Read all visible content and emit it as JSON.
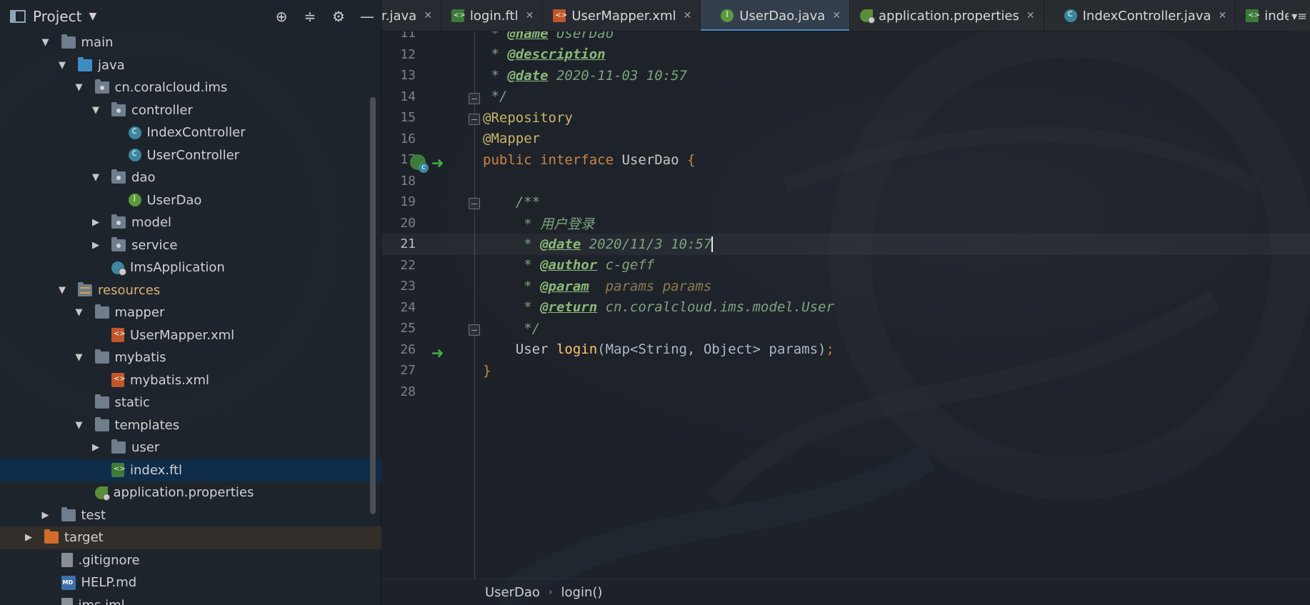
{
  "project_panel": {
    "title": "Project",
    "dropdown": "▼",
    "tools": {
      "locate": "⊕",
      "collapse": "≑",
      "settings": "⚙",
      "hide": "—"
    },
    "tree": [
      {
        "label": "main",
        "icon": "folder-icon",
        "depth": 1,
        "arrow": "▼"
      },
      {
        "label": "java",
        "icon": "source-folder-icon",
        "depth": 2,
        "arrow": "▼"
      },
      {
        "label": "cn.coralcloud.ims",
        "icon": "package-icon",
        "depth": 3,
        "arrow": "▼"
      },
      {
        "label": "controller",
        "icon": "package-icon",
        "depth": 4,
        "arrow": "▼"
      },
      {
        "label": "IndexController",
        "icon": "class-icon",
        "depth": 5,
        "arrow": ""
      },
      {
        "label": "UserController",
        "icon": "class-icon",
        "depth": 5,
        "arrow": ""
      },
      {
        "label": "dao",
        "icon": "package-icon",
        "depth": 4,
        "arrow": "▼"
      },
      {
        "label": "UserDao",
        "icon": "interface-icon",
        "depth": 5,
        "arrow": ""
      },
      {
        "label": "model",
        "icon": "package-icon",
        "depth": 4,
        "arrow": "▶"
      },
      {
        "label": "service",
        "icon": "package-icon",
        "depth": 4,
        "arrow": "▶"
      },
      {
        "label": "ImsApplication",
        "icon": "spring-app-icon",
        "depth": 4,
        "arrow": ""
      },
      {
        "label": "resources",
        "icon": "resources-folder-icon",
        "depth": 2,
        "arrow": "▼"
      },
      {
        "label": "mapper",
        "icon": "folder-icon",
        "depth": 3,
        "arrow": "▼"
      },
      {
        "label": "UserMapper.xml",
        "icon": "xml-file-icon",
        "depth": 4,
        "arrow": ""
      },
      {
        "label": "mybatis",
        "icon": "folder-icon",
        "depth": 3,
        "arrow": "▼"
      },
      {
        "label": "mybatis.xml",
        "icon": "xml-file-icon",
        "depth": 4,
        "arrow": ""
      },
      {
        "label": "static",
        "icon": "folder-icon",
        "depth": 3,
        "arrow": ""
      },
      {
        "label": "templates",
        "icon": "folder-icon",
        "depth": 3,
        "arrow": "▼"
      },
      {
        "label": "user",
        "icon": "folder-icon",
        "depth": 4,
        "arrow": "▶"
      },
      {
        "label": "index.ftl",
        "icon": "ftl-file-icon",
        "depth": 4,
        "arrow": "",
        "selected": true
      },
      {
        "label": "application.properties",
        "icon": "properties-file-icon",
        "depth": 3,
        "arrow": ""
      },
      {
        "label": "test",
        "icon": "folder-icon",
        "depth": 1,
        "arrow": "▶"
      },
      {
        "label": "target",
        "icon": "excluded-folder-icon",
        "depth": 0,
        "arrow": "▶",
        "highlight": true
      },
      {
        "label": ".gitignore",
        "icon": "text-file-icon",
        "depth": 1,
        "arrow": ""
      },
      {
        "label": "HELP.md",
        "icon": "markdown-file-icon",
        "depth": 1,
        "arrow": ""
      },
      {
        "label": "ims.iml",
        "icon": "module-file-icon",
        "depth": 1,
        "arrow": ""
      }
    ]
  },
  "tabs": [
    {
      "label": "r.java",
      "icon": "class-icon",
      "close": "✕"
    },
    {
      "label": "login.ftl",
      "icon": "ftl-file-icon",
      "close": "✕"
    },
    {
      "label": "UserMapper.xml",
      "icon": "xml-file-icon",
      "close": "✕"
    },
    {
      "label": "UserDao.java",
      "icon": "interface-icon",
      "close": "✕",
      "active": true
    },
    {
      "label": "application.properties",
      "icon": "properties-file-icon",
      "close": "✕"
    },
    {
      "label": "IndexController.java",
      "icon": "class-icon",
      "close": "✕"
    },
    {
      "label": "index.ftl",
      "icon": "ftl-file-icon",
      "close": "✕"
    }
  ],
  "tab_menu": "▾≡",
  "editor": {
    "lines": [
      {
        "num": "11",
        "tokens": [
          {
            "t": " * ",
            "c": "c-doc"
          },
          {
            "t": "@name",
            "c": "c-tag"
          },
          {
            "t": " UserDao",
            "c": "c-doc"
          }
        ]
      },
      {
        "num": "12",
        "tokens": [
          {
            "t": " * ",
            "c": "c-doc"
          },
          {
            "t": "@description",
            "c": "c-tag"
          }
        ]
      },
      {
        "num": "13",
        "tokens": [
          {
            "t": " * ",
            "c": "c-doc"
          },
          {
            "t": "@date",
            "c": "c-tag"
          },
          {
            "t": " 2020-11-03 10:57",
            "c": "c-doc"
          }
        ]
      },
      {
        "num": "14",
        "fold": true,
        "tokens": [
          {
            "t": " */",
            "c": "c-doc"
          }
        ]
      },
      {
        "num": "15",
        "fold": true,
        "tokens": [
          {
            "t": "@Repository",
            "c": "c-ann"
          }
        ]
      },
      {
        "num": "16",
        "tokens": [
          {
            "t": "@Mapper",
            "c": "c-ann"
          }
        ]
      },
      {
        "num": "17",
        "spring": true,
        "run": true,
        "tokens": [
          {
            "t": "public ",
            "c": "c-kw"
          },
          {
            "t": "interface ",
            "c": "c-kw"
          },
          {
            "t": "UserDao ",
            "c": "c-type"
          },
          {
            "t": "{",
            "c": "c-brace"
          }
        ]
      },
      {
        "num": "18",
        "tokens": []
      },
      {
        "num": "19",
        "fold": true,
        "tokens": [
          {
            "t": "    /**",
            "c": "c-doc"
          }
        ]
      },
      {
        "num": "20",
        "tokens": [
          {
            "t": "     * 用户登录",
            "c": "c-doc"
          }
        ]
      },
      {
        "num": "21",
        "current": true,
        "tokens": [
          {
            "t": "     * ",
            "c": "c-doc"
          },
          {
            "t": "@date",
            "c": "c-tag"
          },
          {
            "t": " 2020/11/3 10:57",
            "c": "c-doc"
          },
          {
            "t": "",
            "c": "caret"
          }
        ]
      },
      {
        "num": "22",
        "tokens": [
          {
            "t": "     * ",
            "c": "c-doc"
          },
          {
            "t": "@author",
            "c": "c-tag"
          },
          {
            "t": " c-geff",
            "c": "c-doc"
          }
        ]
      },
      {
        "num": "23",
        "tokens": [
          {
            "t": "     * ",
            "c": "c-doc"
          },
          {
            "t": "@param",
            "c": "c-tag"
          },
          {
            "t": "  params params",
            "c": "c-doc-param"
          }
        ]
      },
      {
        "num": "24",
        "tokens": [
          {
            "t": "     * ",
            "c": "c-doc"
          },
          {
            "t": "@return",
            "c": "c-tag"
          },
          {
            "t": " cn.coralcloud.ims.model.User",
            "c": "c-doc"
          }
        ]
      },
      {
        "num": "25",
        "fold": true,
        "tokens": [
          {
            "t": "     */",
            "c": "c-doc"
          }
        ]
      },
      {
        "num": "26",
        "run": true,
        "tokens": [
          {
            "t": "    User ",
            "c": "c-type"
          },
          {
            "t": "login",
            "c": "c-method"
          },
          {
            "t": "(Map<String, Object> params)",
            "c": "c-param"
          },
          {
            "t": ";",
            "c": "c-semi"
          }
        ]
      },
      {
        "num": "27",
        "tokens": [
          {
            "t": "}",
            "c": "c-brace"
          }
        ]
      },
      {
        "num": "28",
        "tokens": []
      }
    ]
  },
  "breadcrumb": {
    "items": [
      "UserDao",
      "login()"
    ],
    "separator": "›"
  }
}
